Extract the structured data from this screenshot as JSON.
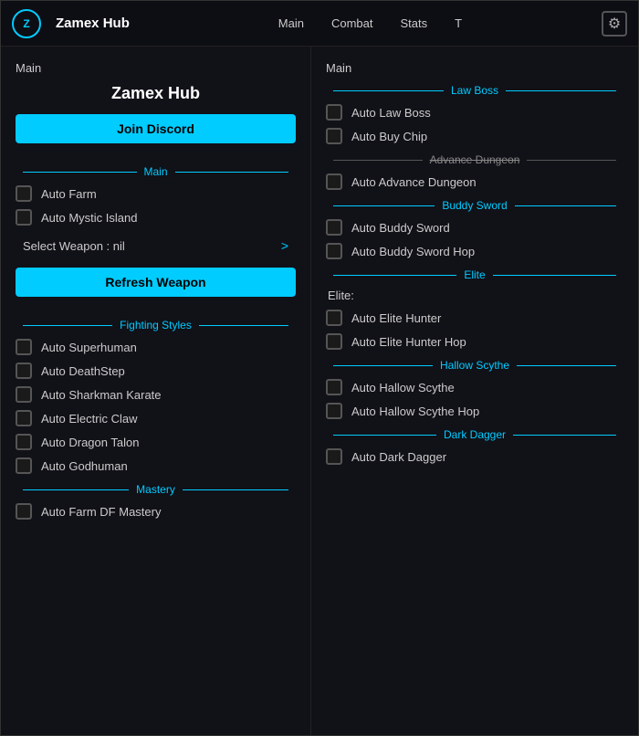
{
  "titleBar": {
    "logoText": "Z",
    "appTitle": "Zamex Hub",
    "navTabs": [
      {
        "label": "Main",
        "id": "main"
      },
      {
        "label": "Combat",
        "id": "combat"
      },
      {
        "label": "Stats",
        "id": "stats"
      },
      {
        "label": "T",
        "id": "t"
      }
    ],
    "gearIcon": "⚙"
  },
  "leftPanel": {
    "sectionTitle": "Main",
    "hubTitle": "Zamex Hub",
    "joinDiscordLabel": "Join Discord",
    "mainDivider": "Main",
    "checkboxItems": [
      {
        "label": "Auto Farm",
        "checked": false
      },
      {
        "label": "Auto Mystic Island",
        "checked": false
      }
    ],
    "selectWeaponText": "Select Weapon : nil",
    "chevron": ">",
    "refreshWeaponLabel": "Refresh Weapon",
    "fightingStylesDivider": "Fighting Styles",
    "fightingItems": [
      {
        "label": "Auto Superhuman",
        "checked": false
      },
      {
        "label": "Auto DeathStep",
        "checked": false
      },
      {
        "label": "Auto Sharkman Karate",
        "checked": false
      },
      {
        "label": "Auto Electric Claw",
        "checked": false
      },
      {
        "label": "Auto Dragon Talon",
        "checked": false
      },
      {
        "label": "Auto Godhuman",
        "checked": false
      }
    ],
    "masteryDivider": "Mastery",
    "masteryItems": [
      {
        "label": "Auto Farm DF Mastery",
        "checked": false
      }
    ]
  },
  "rightPanel": {
    "sectionTitle": "Main",
    "lawBossDivider": "Law Boss",
    "lawBossItems": [
      {
        "label": "Auto Law Boss",
        "checked": false
      },
      {
        "label": "Auto Buy Chip",
        "checked": false
      }
    ],
    "advanceDungeonDivider": "Advance Dungeon",
    "advanceDungeonItems": [
      {
        "label": "Auto Advance Dungeon",
        "checked": false
      }
    ],
    "buddySwordDivider": "Buddy Sword",
    "buddySwordItems": [
      {
        "label": "Auto Buddy Sword",
        "checked": false
      },
      {
        "label": "Auto Buddy Sword Hop",
        "checked": false
      }
    ],
    "eliteDivider": "Elite",
    "eliteSubLabel": "Elite:",
    "eliteItems": [
      {
        "label": "Auto Elite Hunter",
        "checked": false
      },
      {
        "label": "Auto Elite Hunter Hop",
        "checked": false
      }
    ],
    "hallowScytheDivider": "Hallow Scythe",
    "hallowScytheItems": [
      {
        "label": "Auto Hallow Scythe",
        "checked": false
      },
      {
        "label": "Auto Hallow Scythe Hop",
        "checked": false
      }
    ],
    "darkDaggerDivider": "Dark Dagger",
    "darkDaggerItems": [
      {
        "label": "Auto Dark Dagger",
        "checked": false
      }
    ]
  }
}
